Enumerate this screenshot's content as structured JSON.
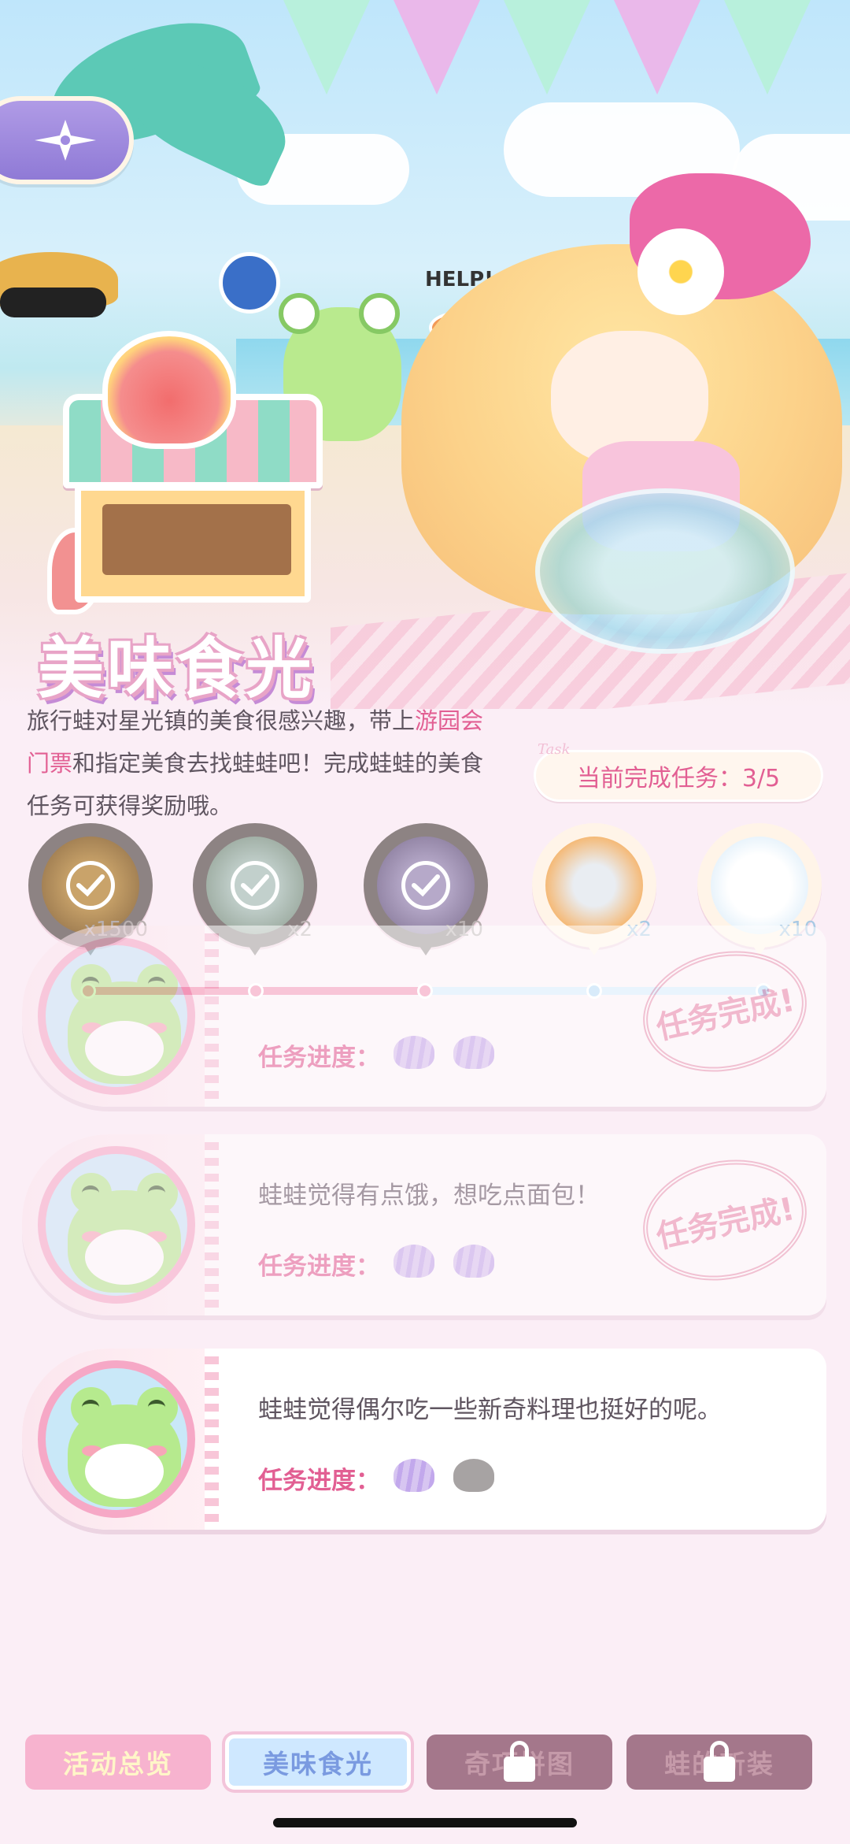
{
  "event": {
    "title": "美味食光",
    "description_parts": [
      "旅行蛙对星光镇的美食很感兴趣，带上",
      "游园会门票",
      "和指定美食去找蛙蛙吧！完成蛙蛙的美食任务可获得奖励哦。"
    ],
    "help_sign": "HELP!"
  },
  "progress": {
    "label": "当前完成任务：3/5",
    "decor_word": "Task",
    "completed": 3,
    "total": 5
  },
  "rewards": [
    {
      "name": "coins-reward",
      "qty": "x1500",
      "claimed": true
    },
    {
      "name": "dish-reward",
      "qty": "x2",
      "claimed": true
    },
    {
      "name": "star-reward",
      "qty": "x10",
      "claimed": true
    },
    {
      "name": "canned-fish-reward",
      "qty": "x2",
      "claimed": false
    },
    {
      "name": "cloud-reward",
      "qty": "x10",
      "claimed": false
    }
  ],
  "tasks": [
    {
      "text": "",
      "progress_label": "任务进度：",
      "stamp": "任务完成!",
      "completed": true
    },
    {
      "text": "蛙蛙觉得有点饿，想吃点面包！",
      "progress_label": "任务进度：",
      "stamp": "任务完成!",
      "completed": true
    },
    {
      "text": "蛙蛙觉得偶尔吃一些新奇料理也挺好的呢。",
      "progress_label": "任务进度：",
      "stamp": "",
      "completed": false
    }
  ],
  "tabs": [
    {
      "label": "活动总览",
      "state": "normal"
    },
    {
      "label": "美味食光",
      "state": "active"
    },
    {
      "label": "奇巧拼图",
      "state": "locked"
    },
    {
      "label": "蛙的新装",
      "state": "locked"
    }
  ],
  "colors": {
    "accent_pink": "#e25f93",
    "progress_fill": "#f07fa7",
    "progress_track": "#cfe7fb",
    "active_tab": "#cfe8ff",
    "locked_tab": "#a4778b"
  }
}
